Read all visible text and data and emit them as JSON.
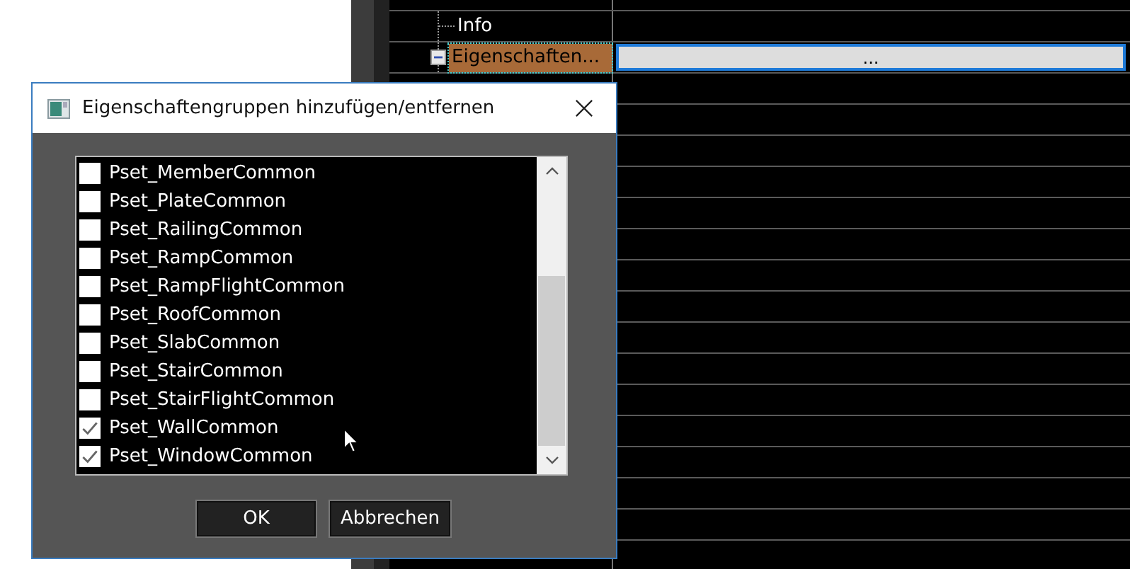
{
  "property_grid": {
    "rows": [
      {
        "label": "Info",
        "selected": false
      },
      {
        "label": "Eigenschaften...",
        "selected": true,
        "expanded": true,
        "value": "..."
      }
    ]
  },
  "dialog": {
    "title": "Eigenschaftengruppen hinzufügen/entfernen",
    "items": [
      {
        "label": "Pset_MemberCommon",
        "checked": false
      },
      {
        "label": "Pset_PlateCommon",
        "checked": false
      },
      {
        "label": "Pset_RailingCommon",
        "checked": false
      },
      {
        "label": "Pset_RampCommon",
        "checked": false
      },
      {
        "label": "Pset_RampFlightCommon",
        "checked": false
      },
      {
        "label": "Pset_RoofCommon",
        "checked": false
      },
      {
        "label": "Pset_SlabCommon",
        "checked": false
      },
      {
        "label": "Pset_StairCommon",
        "checked": false
      },
      {
        "label": "Pset_StairFlightCommon",
        "checked": false
      },
      {
        "label": "Pset_WallCommon",
        "checked": true
      },
      {
        "label": "Pset_WindowCommon",
        "checked": true
      }
    ],
    "buttons": [
      "OK",
      "Abbrechen"
    ]
  }
}
